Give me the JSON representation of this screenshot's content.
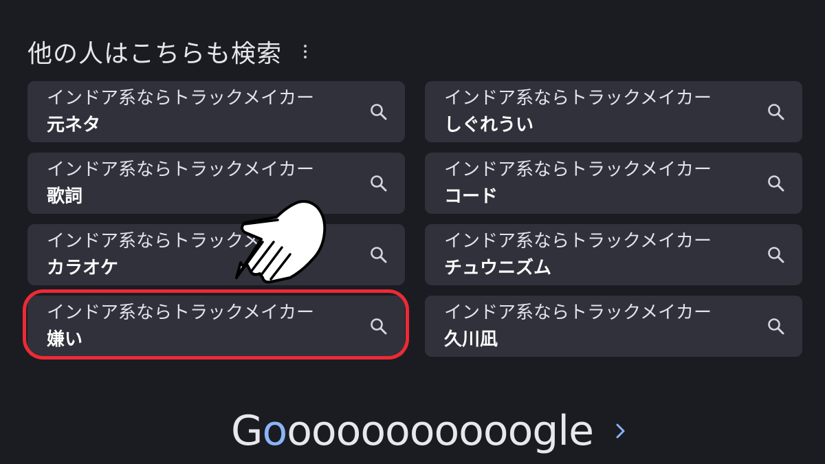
{
  "section": {
    "title": "他の人はこちらも検索",
    "menu_icon": "more-vert-icon"
  },
  "suggestions": [
    {
      "line1": "インドア系ならトラックメイカー",
      "line2": "元ネタ",
      "icon": "search-icon"
    },
    {
      "line1": "インドア系ならトラックメイカー",
      "line2": "しぐれうい",
      "icon": "search-icon"
    },
    {
      "line1": "インドア系ならトラックメイカー",
      "line2": "歌詞",
      "icon": "search-icon"
    },
    {
      "line1": "インドア系ならトラックメイカー",
      "line2": "コード",
      "icon": "search-icon"
    },
    {
      "line1": "インドア系ならトラックメイカー",
      "line2": "カラオケ",
      "icon": "search-icon"
    },
    {
      "line1": "インドア系ならトラックメイカー",
      "line2": "チュウニズム",
      "icon": "search-icon"
    },
    {
      "line1": "インドア系ならトラックメイカー",
      "line2": "嫌い",
      "icon": "search-icon"
    },
    {
      "line1": "インドア系ならトラックメイカー",
      "line2": "久川凪",
      "icon": "search-icon"
    }
  ],
  "highlighted_index": 6,
  "pagination": {
    "logo_g": "G",
    "logo_o_first": "o",
    "logo_rest": "oooooooooogle",
    "next_icon": "chevron-right-icon"
  },
  "colors": {
    "background": "#1b1c22",
    "chip_background": "#30313b",
    "highlight_ring": "#ee2a35",
    "logo_blue": "#8ab4f8"
  },
  "overlay": {
    "pointer_icon": "pointing-hand-icon"
  }
}
